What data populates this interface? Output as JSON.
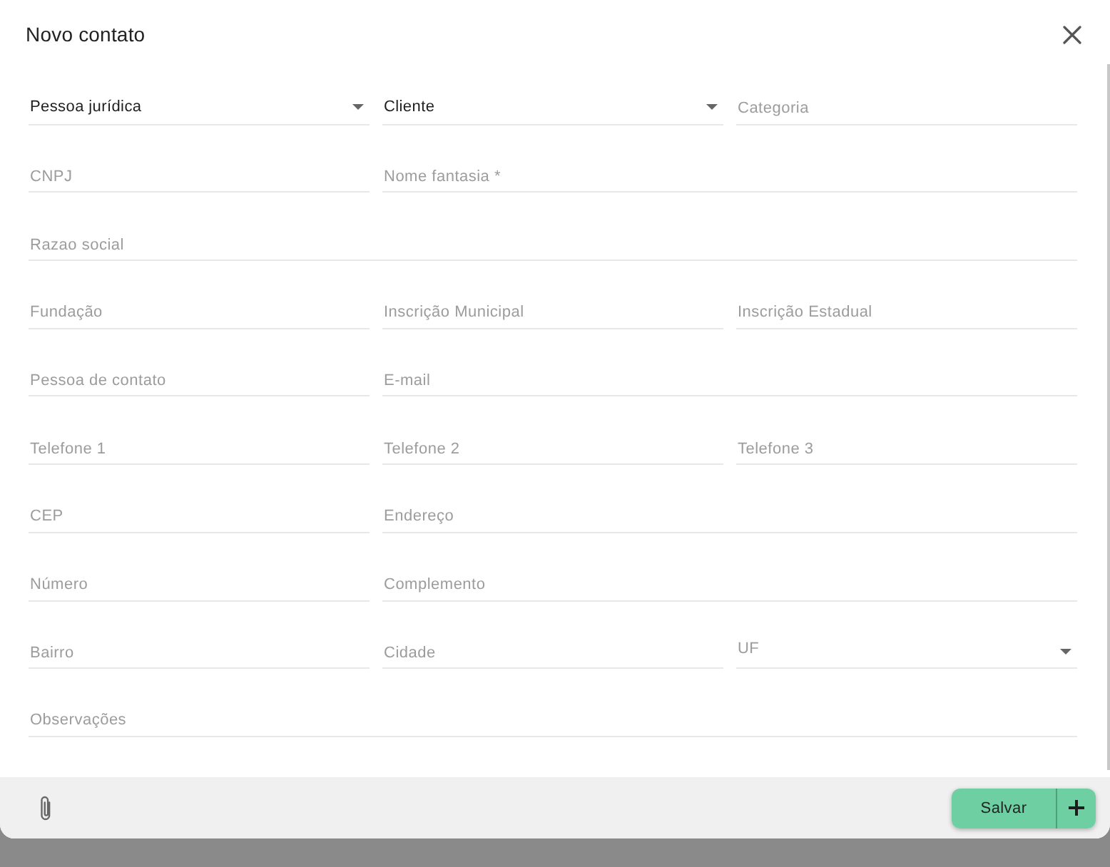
{
  "dialog": {
    "title": "Novo contato"
  },
  "form": {
    "rows": [
      {
        "fields": [
          {
            "kind": "select",
            "value": "Pessoa jurídica"
          },
          {
            "kind": "select",
            "value": "Cliente"
          },
          {
            "kind": "text",
            "placeholder": "Categoria"
          }
        ]
      },
      {
        "fields": [
          {
            "kind": "text",
            "placeholder": "CNPJ"
          },
          {
            "kind": "text",
            "placeholder": "Nome fantasia *"
          }
        ]
      },
      {
        "fields": [
          {
            "kind": "text",
            "placeholder": "Razao social"
          }
        ]
      },
      {
        "fields": [
          {
            "kind": "text",
            "placeholder": "Fundação"
          },
          {
            "kind": "text",
            "placeholder": "Inscrição Municipal"
          },
          {
            "kind": "text",
            "placeholder": "Inscrição Estadual"
          }
        ]
      },
      {
        "fields": [
          {
            "kind": "text",
            "placeholder": "Pessoa de contato"
          },
          {
            "kind": "text",
            "placeholder": "E-mail"
          }
        ]
      },
      {
        "fields": [
          {
            "kind": "text",
            "placeholder": "Telefone 1"
          },
          {
            "kind": "text",
            "placeholder": "Telefone 2"
          },
          {
            "kind": "text",
            "placeholder": "Telefone 3"
          }
        ]
      },
      {
        "fields": [
          {
            "kind": "text",
            "placeholder": "CEP"
          },
          {
            "kind": "text",
            "placeholder": "Endereço"
          }
        ]
      },
      {
        "fields": [
          {
            "kind": "text",
            "placeholder": "Número"
          },
          {
            "kind": "text",
            "placeholder": "Complemento"
          }
        ]
      },
      {
        "fields": [
          {
            "kind": "text",
            "placeholder": "Bairro"
          },
          {
            "kind": "text",
            "placeholder": "Cidade"
          },
          {
            "kind": "select",
            "placeholder": "UF"
          }
        ]
      },
      {
        "fields": [
          {
            "kind": "text",
            "placeholder": "Observações"
          }
        ]
      }
    ]
  },
  "footer": {
    "save_button": {
      "label": "Salvar"
    }
  }
}
